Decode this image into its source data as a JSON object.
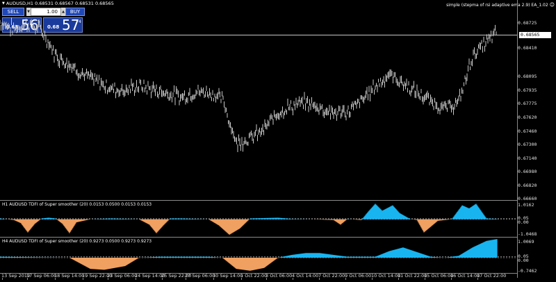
{
  "header": {
    "symbol_line": "AUDUSD,H1  0.68531 0.68567 0.68531 0.68565",
    "ea_label": "simple (stepma of rsi adaptive ema 2.9) EA_1.02",
    "ea_icon": "smiley-icon"
  },
  "trade_panel": {
    "sell_label": "SELL",
    "buy_label": "BUY",
    "lot_value": "1.00",
    "sell_quote": {
      "prefix": "0.68",
      "big": "56",
      "sup": "5"
    },
    "buy_quote": {
      "prefix": "0.68",
      "big": "57",
      "sup": "4"
    },
    "colors": {
      "panel": "#2048b8",
      "quote": "#1a3a9c"
    }
  },
  "price_axis": {
    "current_price": "0.68565",
    "ticks": [
      "0.68725",
      "0.68410",
      "0.68095",
      "0.67935",
      "0.67775",
      "0.67620",
      "0.67460",
      "0.67300",
      "0.67140",
      "0.66980",
      "0.66820",
      "0.66660"
    ]
  },
  "indicator1": {
    "label": "H1 AUDUSD TDFI of Super smoother (20) 0.0153 0.0500 0.0153 0.0153",
    "ticks": [
      "1.0162",
      "0.05",
      "0.00",
      "-1.0468"
    ],
    "colors": {
      "positive": "#19b4f0",
      "negative": "#f0a060"
    }
  },
  "indicator2": {
    "label": "H4 AUDUSD TDFI of Super smoother (20) 0.9273 0.0500 0.9273 0.9273",
    "ticks": [
      "1.0069",
      "0.05",
      "0.00",
      "-0.7462"
    ],
    "colors": {
      "positive": "#19b4f0",
      "negative": "#f0a060"
    }
  },
  "time_axis": {
    "labels": [
      "13 Sep 2019",
      "17 Sep 06:00",
      "18 Sep 14:00",
      "19 Sep 22:00",
      "23 Sep 06:00",
      "24 Sep 14:00",
      "25 Sep 22:00",
      "27 Sep 06:00",
      "30 Sep 14:00",
      "1 Oct 22:00",
      "3 Oct 06:00",
      "4 Oct 14:00",
      "7 Oct 22:00",
      "9 Oct 06:00",
      "10 Oct 14:00",
      "11 Oct 22:00",
      "15 Oct 06:00",
      "16 Oct 14:00",
      "17 Oct 22:00"
    ]
  },
  "chart_data": [
    {
      "type": "line",
      "title": "AUDUSD,H1",
      "ylim": [
        0.6666,
        0.6887
      ],
      "x": [
        0,
        20,
        40,
        60,
        80,
        100,
        120,
        140,
        160,
        180,
        200,
        220,
        240,
        260,
        280,
        300,
        320,
        340,
        360,
        380,
        400,
        420,
        440,
        460,
        480,
        500,
        520,
        540,
        560,
        580,
        600,
        620,
        640,
        660,
        680,
        700,
        715
      ],
      "series": [
        {
          "values": [
            0.6868,
            0.686,
            0.6866,
            0.6858,
            0.683,
            0.682,
            0.6808,
            0.68,
            0.6792,
            0.679,
            0.6795,
            0.6791,
            0.6787,
            0.6782,
            0.6788,
            0.6788,
            0.678,
            0.673,
            0.6735,
            0.6745,
            0.6765,
            0.6772,
            0.6776,
            0.677,
            0.6764,
            0.6765,
            0.6778,
            0.6795,
            0.6808,
            0.6798,
            0.6787,
            0.6777,
            0.6769,
            0.6776,
            0.683,
            0.6845,
            0.6857
          ]
        }
      ],
      "current_price": 0.68565
    },
    {
      "type": "area",
      "title": "H1 AUDUSD TDFI of Super smoother (20)",
      "ylim": [
        -1.0468,
        1.0162
      ],
      "levels": [
        0.05,
        0.0
      ],
      "x": [
        0,
        20,
        30,
        40,
        50,
        60,
        70,
        80,
        90,
        100,
        110,
        130,
        160,
        200,
        215,
        225,
        235,
        245,
        260,
        300,
        315,
        330,
        345,
        360,
        400,
        420,
        450,
        480,
        490,
        500,
        520,
        530,
        540,
        550,
        565,
        575,
        590,
        600,
        610,
        630,
        650,
        665,
        675,
        685,
        700,
        715
      ],
      "series": [
        {
          "values": [
            0.05,
            -0.05,
            -0.25,
            -0.85,
            -0.3,
            0.05,
            0.1,
            0.05,
            -0.3,
            -0.9,
            -0.2,
            0.0,
            0.05,
            0.0,
            -0.35,
            -0.9,
            -0.4,
            0.05,
            0.05,
            0.0,
            -0.4,
            -1.0,
            -0.6,
            0.05,
            0.1,
            0.02,
            0.0,
            -0.05,
            -0.35,
            0.02,
            -0.05,
            0.5,
            1.0,
            0.55,
            0.9,
            0.4,
            0.02,
            -0.05,
            -0.85,
            -0.1,
            0.0,
            0.9,
            0.7,
            1.0,
            0.05,
            0.02
          ]
        }
      ]
    },
    {
      "type": "area",
      "title": "H4 AUDUSD TDFI of Super smoother (20)",
      "ylim": [
        -0.7462,
        1.0069
      ],
      "levels": [
        0.05,
        0.0
      ],
      "x": [
        0,
        60,
        100,
        130,
        150,
        180,
        200,
        230,
        300,
        320,
        340,
        360,
        380,
        400,
        420,
        440,
        460,
        500,
        540,
        560,
        580,
        600,
        620,
        640,
        660,
        680,
        700,
        715
      ],
      "series": [
        {
          "values": [
            0.05,
            0.02,
            0.0,
            -0.6,
            -0.65,
            -0.45,
            0.0,
            0.05,
            0.05,
            0.0,
            -0.6,
            -0.7,
            -0.55,
            0.0,
            0.15,
            0.25,
            0.25,
            0.05,
            0.05,
            0.35,
            0.55,
            0.3,
            0.05,
            0.0,
            0.1,
            0.55,
            0.9,
            1.0
          ]
        }
      ]
    }
  ]
}
